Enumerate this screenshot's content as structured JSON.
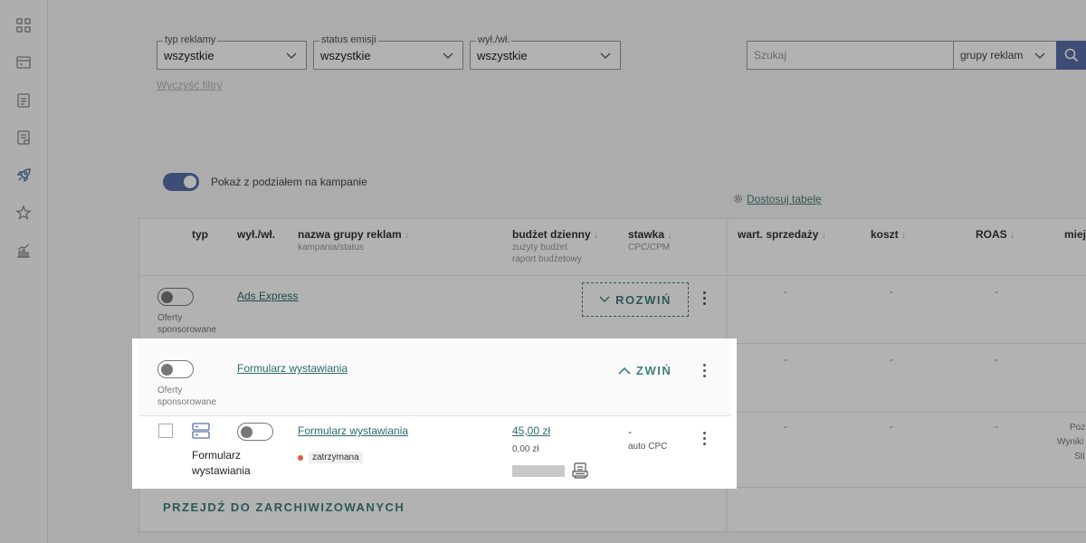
{
  "filters": {
    "ad_type": {
      "legend": "typ reklamy",
      "value": "wszystkie"
    },
    "emission_status": {
      "legend": "status emisji",
      "value": "wszystkie"
    },
    "on_off": {
      "legend": "wył./wł.",
      "value": "wszystkie"
    },
    "clear": "Wyczyść filtry"
  },
  "search": {
    "placeholder": "Szukaj",
    "scope": "grupy reklam"
  },
  "toggle": {
    "label": "Pokaż z podziałem na kampanie"
  },
  "customize": "Dostosuj tabelę",
  "headers": {
    "type": "typ",
    "onoff": "wył./wł.",
    "name": "nazwa grupy reklam",
    "name_sub": "kampania/status",
    "budget": "budżet dzienny",
    "budget_sub1": "zużyty budżet",
    "budget_sub2": "raport budżetowy",
    "bid": "stawka",
    "bid_sub": "CPC/CPM",
    "sales": "wart. sprzedaży",
    "cost": "koszt",
    "roas": "ROAS",
    "place": "miej"
  },
  "rows": [
    {
      "type_label1": "Oferty",
      "type_label2": "sponsorowane",
      "name": "Ads Express",
      "action": "ROZWIŃ",
      "sales": "-",
      "cost": "-",
      "roas": "-"
    },
    {
      "type_label1": "Oferty",
      "type_label2": "sponsorowane",
      "name": "Formularz wystawiania",
      "action": "ZWIŃ",
      "sales": "-",
      "cost": "-",
      "roas": "-"
    }
  ],
  "sub_row": {
    "type_line1": "Formularz",
    "type_line2": "wystawiania",
    "name": "Formularz wystawiania",
    "status": "zatrzymana",
    "budget": "45,00 zł",
    "spent": "0,00 zł",
    "bid": "-",
    "bid_type": "auto CPC",
    "sales": "-",
    "cost": "-",
    "roas": "-",
    "place1": "Poz",
    "place2": "Wyniki",
    "place3": "Sti"
  },
  "archive": "PRZEJDŹ DO ZARCHIWIZOWANYCH",
  "colors": {
    "accent": "#3f7f7d",
    "primary": "#5a6fa8",
    "status_stopped": "#d9603b"
  }
}
